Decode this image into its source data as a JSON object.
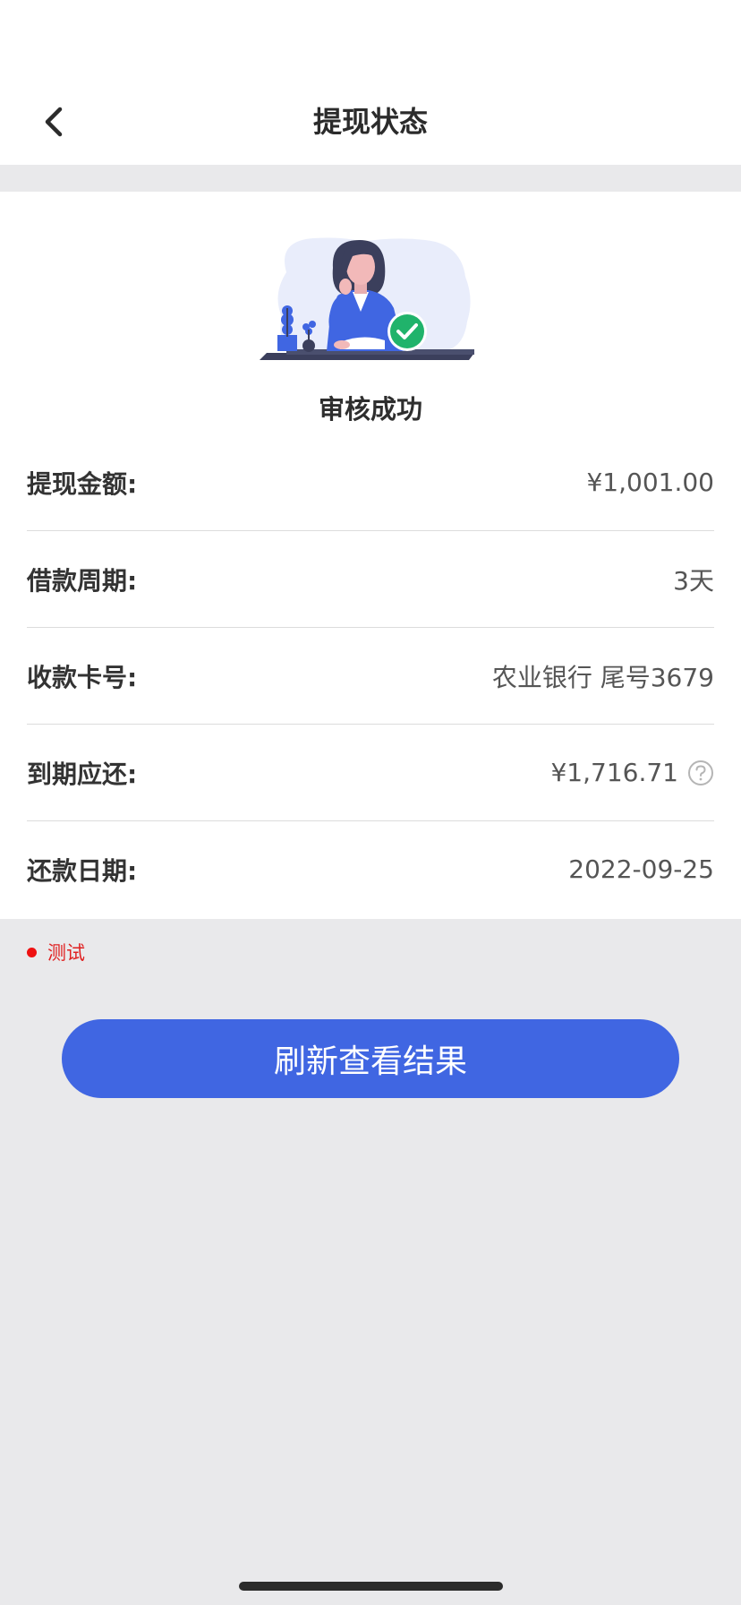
{
  "nav": {
    "title": "提现状态",
    "back_icon": "chevron-left-icon"
  },
  "status": {
    "illustration": "review-success-illustration",
    "text": "审核成功",
    "accent_color": "#20b36b"
  },
  "details": [
    {
      "label": "提现金额:",
      "value": "¥1,001.00"
    },
    {
      "label": "借款周期:",
      "value": "3天"
    },
    {
      "label": "收款卡号:",
      "value": "农业银行 尾号3679"
    },
    {
      "label": "到期应还:",
      "value": "¥1,716.71",
      "icon": "question-circle-icon"
    },
    {
      "label": "还款日期:",
      "value": "2022-09-25"
    }
  ],
  "test_tag": {
    "text": "测试",
    "color": "#e02020"
  },
  "refresh_button": {
    "label": "刷新查看结果",
    "color": "#4066e2"
  }
}
